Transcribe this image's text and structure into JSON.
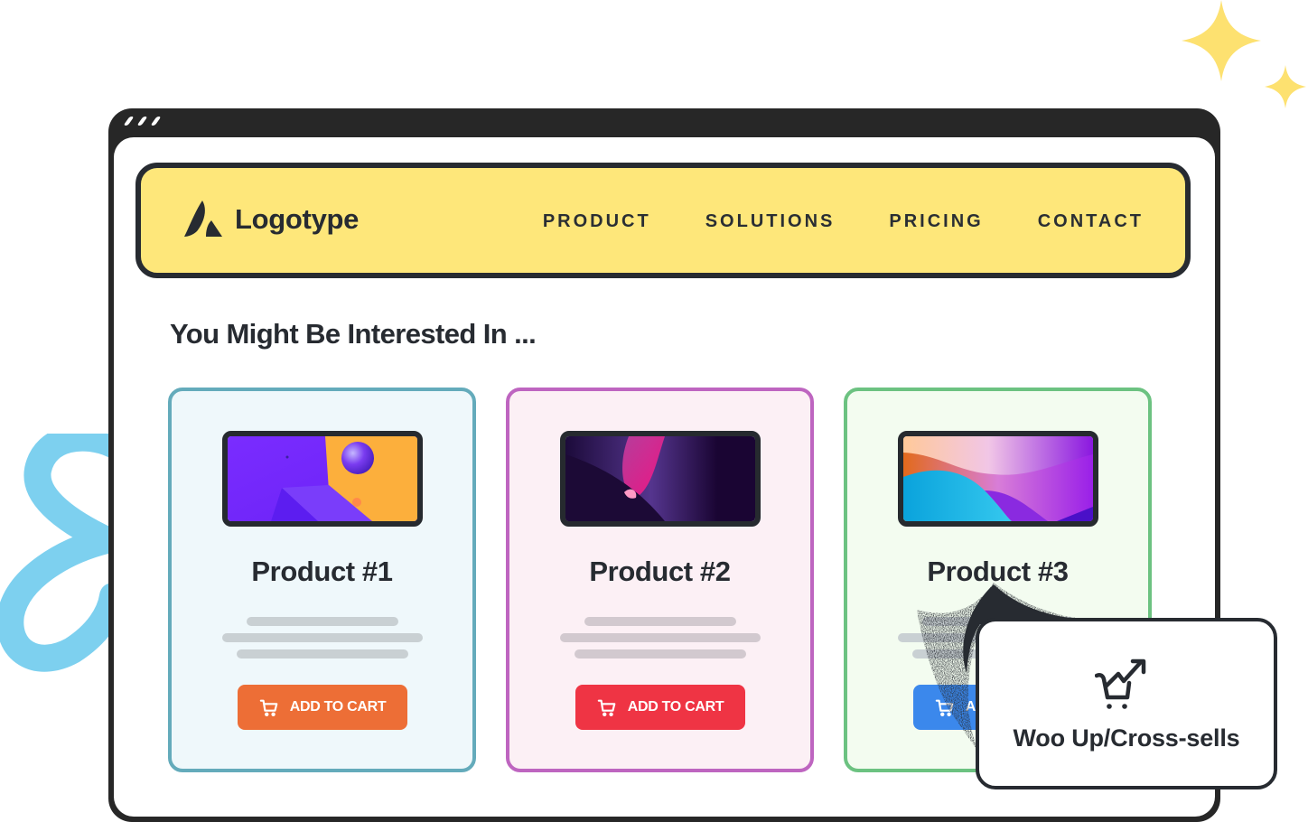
{
  "colors": {
    "frame": "#272727",
    "nav_bg": "#fee77a",
    "text_dark": "#272b31",
    "sparkle": "#fde170",
    "squiggle": "#7dd0ef"
  },
  "browser": {
    "title_bar_icon": "window-dots-icon"
  },
  "navbar": {
    "logo_icon": "logo-mark-icon",
    "logo_text": "Logotype",
    "links": [
      {
        "label": "PRODUCT"
      },
      {
        "label": "SOLUTIONS"
      },
      {
        "label": "PRICING"
      },
      {
        "label": "CONTACT"
      }
    ]
  },
  "section": {
    "title": "You Might Be Interested In ..."
  },
  "products": [
    {
      "name": "Product #1",
      "button_label": "ADD TO CART",
      "button_icon": "cart-icon",
      "button_color": "#ed6e36",
      "card_border": "#64abbb",
      "card_bg": "#eff8fb",
      "image": "purple-orange-3d-spheres"
    },
    {
      "name": "Product #2",
      "button_label": "ADD TO CART",
      "button_icon": "cart-icon",
      "button_color": "#ef3444",
      "card_border": "#be65c0",
      "card_bg": "#fcf0f5",
      "image": "dark-purple-pink-abstract"
    },
    {
      "name": "Product #3",
      "button_label": "ADD TO CART",
      "button_icon": "cart-icon",
      "button_color": "#3b88ec",
      "card_border": "#6cc281",
      "card_bg": "#f3fcf0",
      "image": "orange-blue-purple-waves"
    }
  ],
  "badge": {
    "icon": "cart-trend-up-icon",
    "label": "Woo Up/Cross-sells"
  }
}
